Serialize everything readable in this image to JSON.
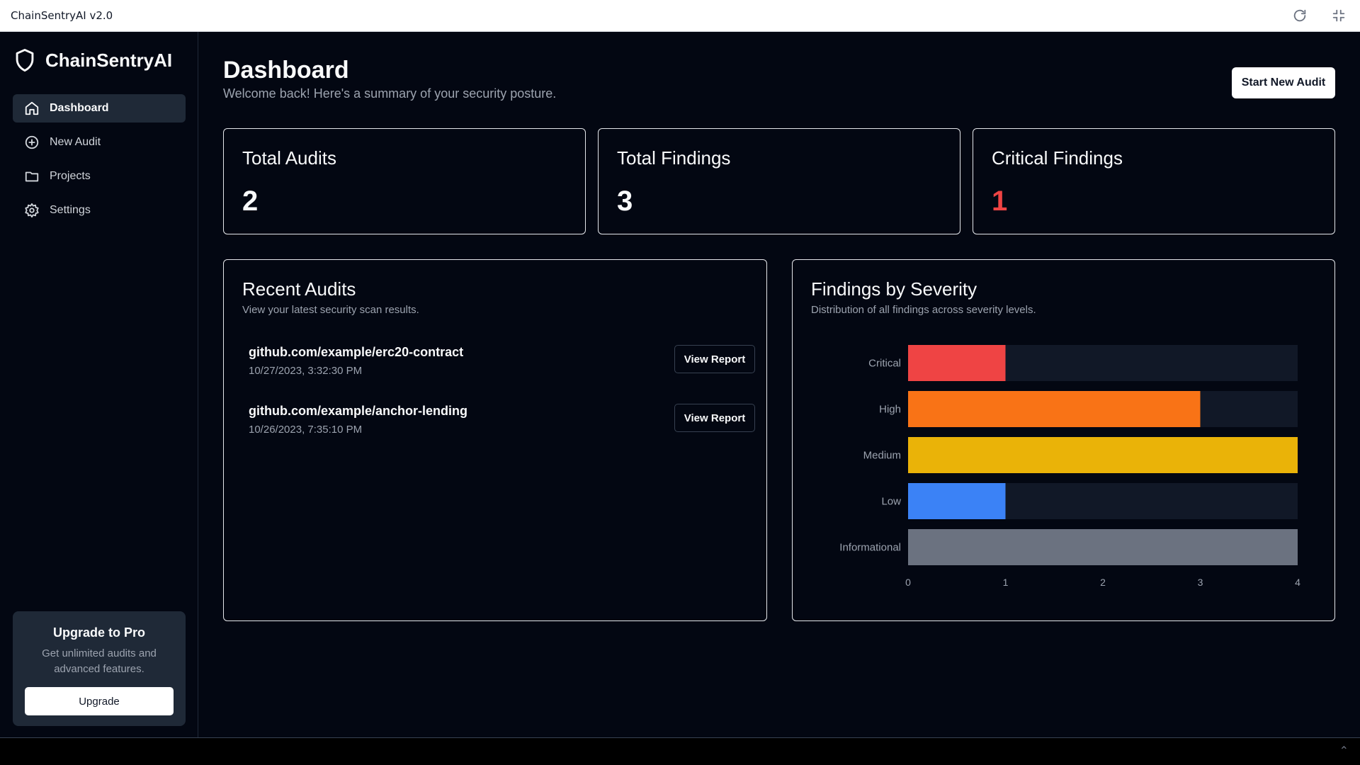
{
  "window": {
    "title": "ChainSentryAI v2.0"
  },
  "sidebar": {
    "brand": "ChainSentryAI",
    "items": [
      {
        "label": "Dashboard",
        "icon": "home-icon",
        "active": true
      },
      {
        "label": "New Audit",
        "icon": "plus-circle-icon",
        "active": false
      },
      {
        "label": "Projects",
        "icon": "folder-icon",
        "active": false
      },
      {
        "label": "Settings",
        "icon": "gear-icon",
        "active": false
      }
    ],
    "upgrade": {
      "title": "Upgrade to Pro",
      "text": "Get unlimited audits and advanced features.",
      "button": "Upgrade"
    }
  },
  "header": {
    "title": "Dashboard",
    "subtitle": "Welcome back! Here's a summary of your security posture.",
    "action": "Start New Audit"
  },
  "stats": [
    {
      "label": "Total Audits",
      "value": "2"
    },
    {
      "label": "Total Findings",
      "value": "3"
    },
    {
      "label": "Critical Findings",
      "value": "1"
    }
  ],
  "recent_audits": {
    "title": "Recent Audits",
    "subtitle": "View your latest security scan results.",
    "items": [
      {
        "repo": "github.com/example/erc20-contract",
        "date": "10/27/2023, 3:32:30 PM",
        "action": "View Report"
      },
      {
        "repo": "github.com/example/anchor-lending",
        "date": "10/26/2023, 7:35:10 PM",
        "action": "View Report"
      }
    ]
  },
  "severity_panel": {
    "title": "Findings by Severity",
    "subtitle": "Distribution of all findings across severity levels."
  },
  "colors": {
    "critical": "#ef4444",
    "high": "#f97316",
    "medium": "#eab308",
    "low": "#3b82f6",
    "informational": "#6b7280",
    "track": "#111827"
  },
  "chart_data": {
    "type": "bar",
    "orientation": "horizontal",
    "categories": [
      "Critical",
      "High",
      "Medium",
      "Low",
      "Informational"
    ],
    "values": [
      1,
      3,
      4,
      1,
      4
    ],
    "xlim": [
      0,
      4
    ],
    "xticks": [
      "0",
      "1",
      "2",
      "3",
      "4"
    ],
    "grid": false,
    "legend": "none"
  }
}
